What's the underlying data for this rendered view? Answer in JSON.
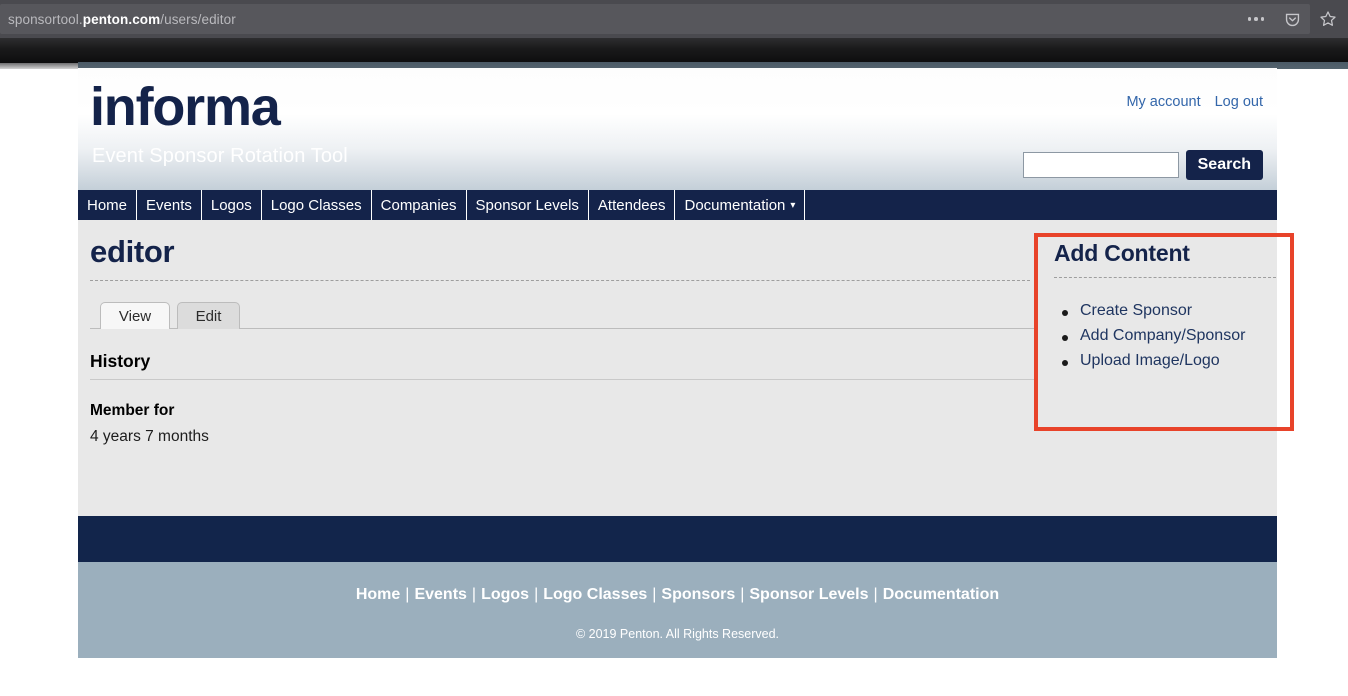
{
  "browser": {
    "url_prefix": "sponsortool.",
    "url_domain": "penton.com",
    "url_path": "/users/editor",
    "icons": [
      {
        "name": "page-actions-more-icon",
        "glyph": "•••"
      },
      {
        "name": "pocket-icon",
        "glyph": "⬡"
      },
      {
        "name": "bookmark-star-icon",
        "glyph": "☆"
      }
    ]
  },
  "header": {
    "logo": "informa",
    "tagline": "Event Sponsor Rotation Tool",
    "account_links": [
      {
        "label": "My account"
      },
      {
        "label": "Log out"
      }
    ],
    "search": {
      "value": "",
      "placeholder": "",
      "button_label": "Search"
    }
  },
  "nav": {
    "items": [
      {
        "label": "Home"
      },
      {
        "label": "Events"
      },
      {
        "label": "Logos"
      },
      {
        "label": "Logo Classes"
      },
      {
        "label": "Companies"
      },
      {
        "label": "Sponsor Levels"
      },
      {
        "label": "Attendees"
      },
      {
        "label": "Documentation",
        "caret": "▾"
      }
    ]
  },
  "main": {
    "title": "editor",
    "tabs": [
      {
        "label": "View",
        "active": true
      },
      {
        "label": "Edit",
        "active": false
      }
    ],
    "history_heading": "History",
    "member_label": "Member for",
    "member_value": "4 years 7 months"
  },
  "sidebar": {
    "title": "Add Content",
    "items": [
      {
        "label": "Create Sponsor"
      },
      {
        "label": "Add Company/Sponsor"
      },
      {
        "label": "Upload Image/Logo"
      }
    ],
    "highlight_color": "#e8432a"
  },
  "footer": {
    "links": [
      {
        "label": "Home"
      },
      {
        "label": "Events"
      },
      {
        "label": "Logos"
      },
      {
        "label": "Logo Classes"
      },
      {
        "label": "Sponsors"
      },
      {
        "label": "Sponsor Levels"
      },
      {
        "label": "Documentation"
      }
    ],
    "separator": "|",
    "copyright": "© 2019 Penton. All Rights Reserved."
  },
  "colors": {
    "navy": "#14234a",
    "footer_blue": "#9bafbd",
    "link_blue": "#3366aa",
    "highlight_red": "#e8432a"
  }
}
